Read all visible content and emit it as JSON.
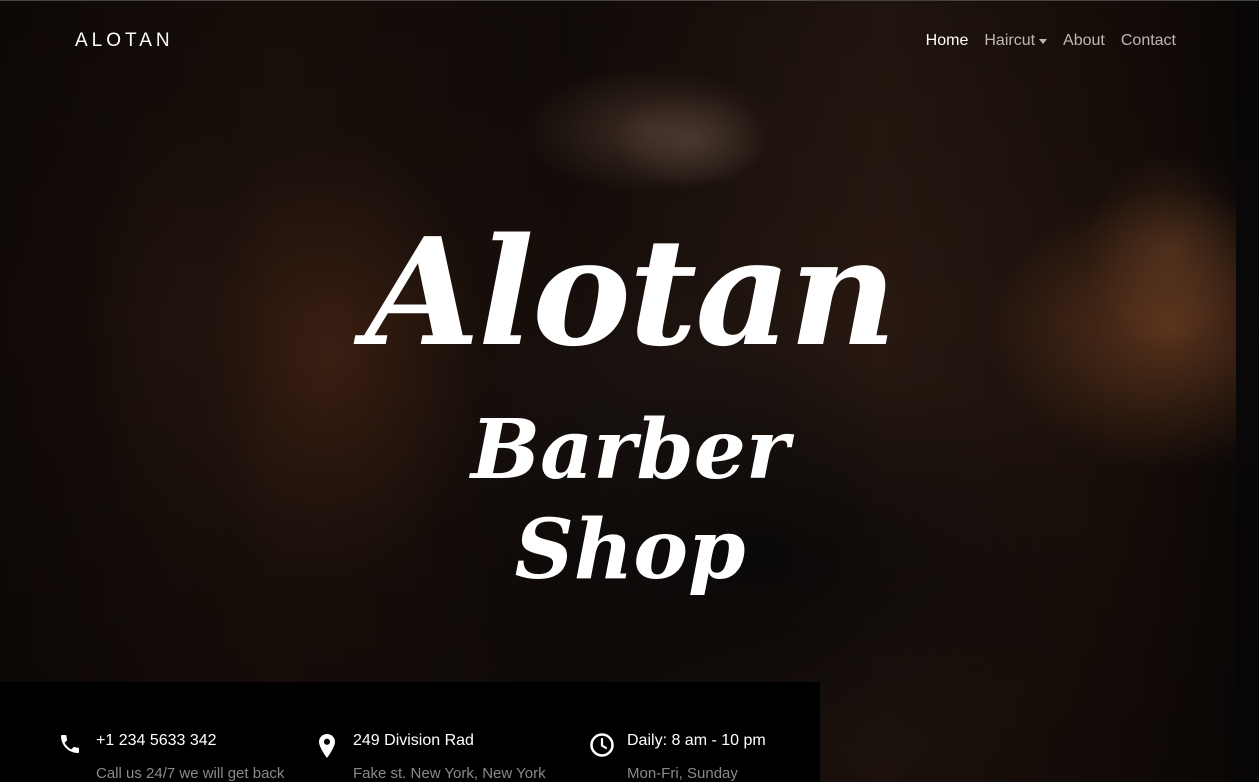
{
  "header": {
    "brand": "ALOTAN",
    "nav": [
      {
        "label": "Home",
        "active": true
      },
      {
        "label": "Haircut",
        "dropdown": true
      },
      {
        "label": "About"
      },
      {
        "label": "Contact"
      }
    ]
  },
  "hero": {
    "title": "Alotan",
    "subtitle": "Barber Shop"
  },
  "info": [
    {
      "icon": "phone-icon",
      "title": "+1 234 5633 342",
      "subtitle": "Call us 24/7 we will get back"
    },
    {
      "icon": "location-pin-icon",
      "title": "249 Division Rad",
      "subtitle": "Fake st. New York, New York"
    },
    {
      "icon": "clock-icon",
      "title": "Daily: 8 am - 10 pm",
      "subtitle": "Mon-Fri, Sunday"
    }
  ],
  "colors": {
    "accent": "#ffffff",
    "muted_text": "#8d8986",
    "info_bg": "#000000"
  }
}
